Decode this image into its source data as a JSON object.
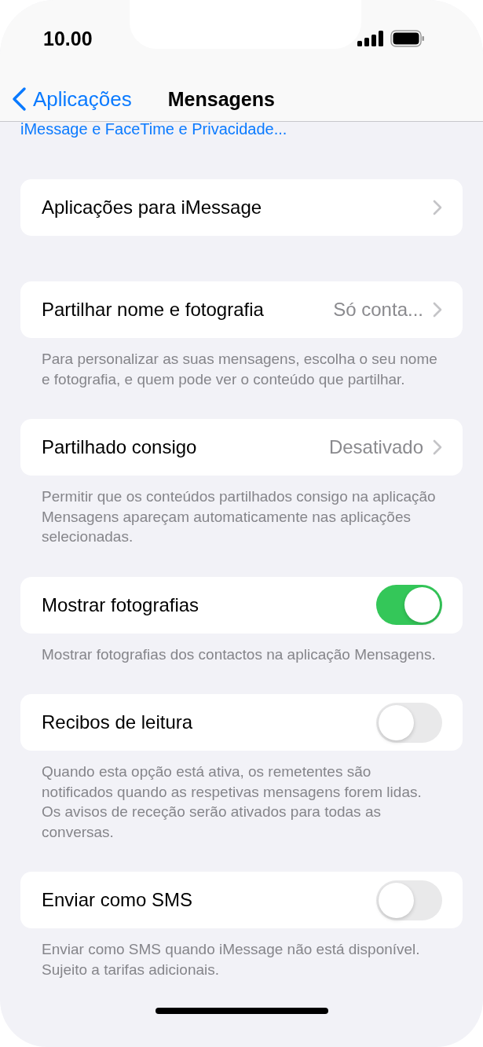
{
  "status_bar": {
    "time": "10.00"
  },
  "nav": {
    "back_label": "Aplicações",
    "title": "Mensagens"
  },
  "top_link": "iMessage e FaceTime e Privacidade...",
  "sections": [
    {
      "rows": [
        {
          "kind": "link",
          "label": "Aplicações para iMessage"
        }
      ]
    },
    {
      "rows": [
        {
          "kind": "link",
          "label": "Partilhar nome e fotografia",
          "value": "Só conta..."
        }
      ],
      "footer": "Para personalizar as suas mensagens, escolha o seu nome e fotografia, e quem pode ver o conteúdo que partilhar."
    },
    {
      "rows": [
        {
          "kind": "link",
          "label": "Partilhado consigo",
          "value": "Desativado"
        }
      ],
      "footer": "Permitir que os conteúdos partilhados consigo na aplicação Mensagens apareçam automaticamente nas aplicações selecionadas."
    },
    {
      "rows": [
        {
          "kind": "toggle",
          "label": "Mostrar fotografias",
          "on": true
        }
      ],
      "footer": "Mostrar fotografias dos contactos na aplicação Mensagens."
    },
    {
      "rows": [
        {
          "kind": "toggle",
          "label": "Recibos de leitura",
          "on": false
        }
      ],
      "footer": "Quando esta opção está ativa, os remetentes são notificados quando as respetivas mensagens forem lidas. Os avisos de receção serão ativados para todas as conversas."
    },
    {
      "rows": [
        {
          "kind": "toggle",
          "label": "Enviar como SMS",
          "on": false
        }
      ],
      "footer": "Enviar como SMS quando iMessage não está disponível. Sujeito a tarifas adicionais."
    }
  ]
}
